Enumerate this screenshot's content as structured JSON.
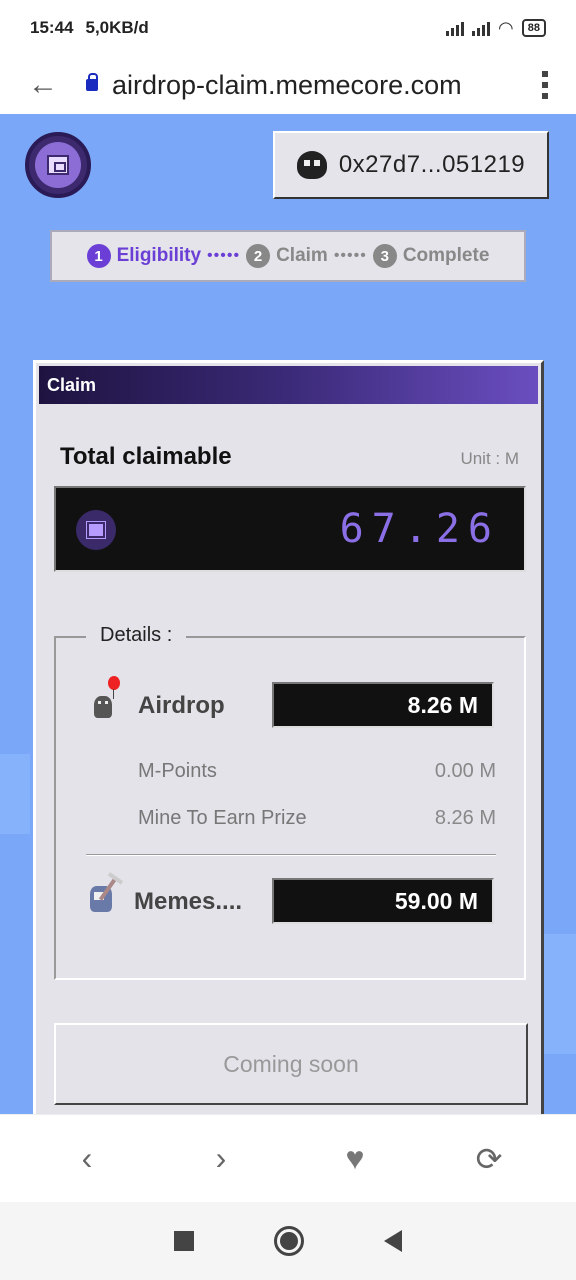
{
  "status_bar": {
    "time": "15:44",
    "speed": "5,0KB/d",
    "battery": "88"
  },
  "browser": {
    "url": "airdrop-claim.memecore.com"
  },
  "header": {
    "wallet_address": "0x27d7...051219"
  },
  "stepper": {
    "steps": [
      {
        "num": "1",
        "label": "Eligibility"
      },
      {
        "num": "2",
        "label": "Claim"
      },
      {
        "num": "3",
        "label": "Complete"
      }
    ]
  },
  "card": {
    "title": "Claim",
    "total_label": "Total claimable",
    "unit_label": "Unit : M",
    "total_value": "67.26",
    "details_label": "Details :",
    "airdrop": {
      "label": "Airdrop",
      "value": "8.26  M",
      "sub_items": [
        {
          "label": "M-Points",
          "value": "0.00 M"
        },
        {
          "label": "Mine To Earn Prize",
          "value": "8.26 M"
        }
      ]
    },
    "memes": {
      "label": "Memes....",
      "value": "59.00  M"
    },
    "action_button": "Coming soon"
  },
  "browser_nav": {
    "back": "‹",
    "forward": "›",
    "favorite": "♥",
    "refresh": "⟳"
  },
  "colors": {
    "page_bg": "#7aa7f7",
    "accent": "#6b3fd6",
    "digital_value": "#8b6fe6"
  }
}
